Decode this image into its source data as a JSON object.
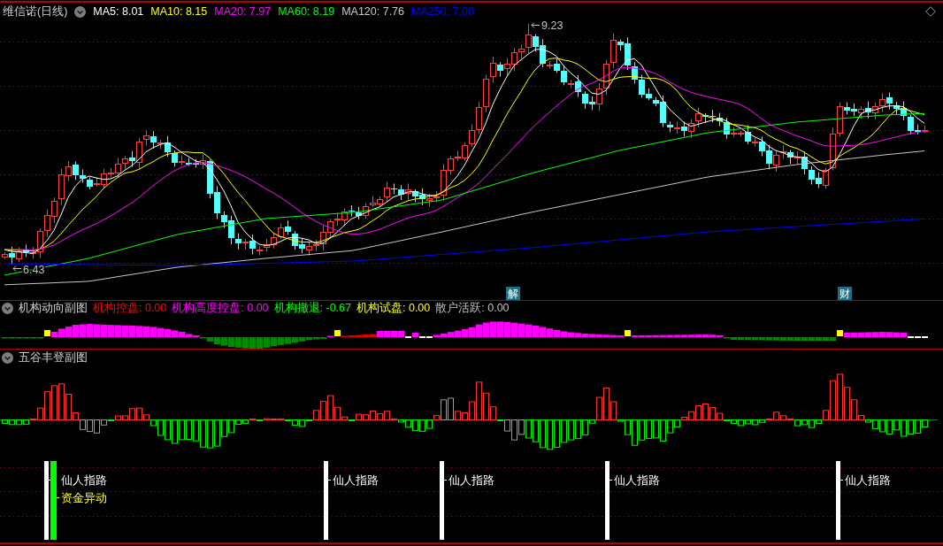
{
  "header": {
    "title": "维信诺(日线)",
    "ma_legend": [
      {
        "label": "MA5: 8.01",
        "color": "#ffffff"
      },
      {
        "label": "MA10: 8.15",
        "color": "#ffff00"
      },
      {
        "label": "MA20: 7.97",
        "color": "#ff00ff"
      },
      {
        "label": "MA60: 8.19",
        "color": "#00ff00"
      },
      {
        "label": "MA120: 7.76",
        "color": "#c8c8c8"
      },
      {
        "label": "MA250: 7.00",
        "color": "#0000ff"
      }
    ]
  },
  "price_chart": {
    "high_label": "9.23",
    "low_label": "6.43",
    "event_badges": [
      {
        "text": "解"
      },
      {
        "text": "财"
      }
    ]
  },
  "indicator_panel": {
    "title": "机构动向副图",
    "legend": [
      {
        "label": "机构控盘: 0.00",
        "color": "#ff0000"
      },
      {
        "label": "机构高度控盘: 0.00",
        "color": "#ff00ff"
      },
      {
        "label": "机构撤退: -0.67",
        "color": "#00ff00"
      },
      {
        "label": "机构试盘: 0.00",
        "color": "#ffff00"
      },
      {
        "label": "散户活跃: 0.00",
        "color": "#c0c0c0"
      }
    ]
  },
  "signal_panel": {
    "title": "五谷丰登副图",
    "signals": [
      {
        "kind": "guide",
        "label": "仙人指路"
      },
      {
        "kind": "capital",
        "label": "资金异动"
      },
      {
        "kind": "guide",
        "label": "仙人指路"
      },
      {
        "kind": "guide",
        "label": "仙人指路"
      },
      {
        "kind": "guide",
        "label": "仙人指路"
      },
      {
        "kind": "guide",
        "label": "仙人指路"
      }
    ]
  }
}
